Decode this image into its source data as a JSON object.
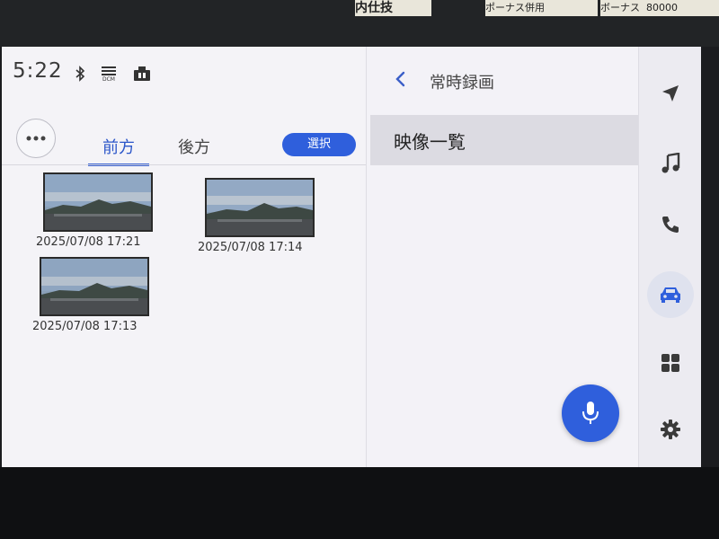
{
  "background_papers": [
    "ポーナス併用",
    "ボーナス",
    "80000"
  ],
  "status": {
    "time": "5:22",
    "icons": [
      "bluetooth-icon",
      "dcm-icon",
      "dashcam-icon"
    ],
    "dcm_label": "DCM"
  },
  "tabs": [
    {
      "label": "前方",
      "active": true
    },
    {
      "label": "後方",
      "active": false
    }
  ],
  "select_label": "選択",
  "videos": [
    {
      "date": "2025/07/08 17:21"
    },
    {
      "date": "2025/07/08 17:14"
    },
    {
      "date": "2025/07/08 17:13"
    }
  ],
  "detail": {
    "back_label": "<",
    "title": "常時録画",
    "items": [
      "映像一覧"
    ]
  },
  "side_nav": [
    {
      "icon": "navigation-arrow-icon",
      "active": false
    },
    {
      "icon": "music-note-icon",
      "active": false
    },
    {
      "icon": "phone-icon",
      "active": false
    },
    {
      "icon": "car-icon",
      "active": true
    },
    {
      "icon": "apps-grid-icon",
      "active": false
    },
    {
      "icon": "settings-gear-icon",
      "active": false
    }
  ],
  "colors": {
    "accent": "#2f5fdc",
    "tab_active": "#2b56c9",
    "screen_bg": "#f2f1f6"
  }
}
